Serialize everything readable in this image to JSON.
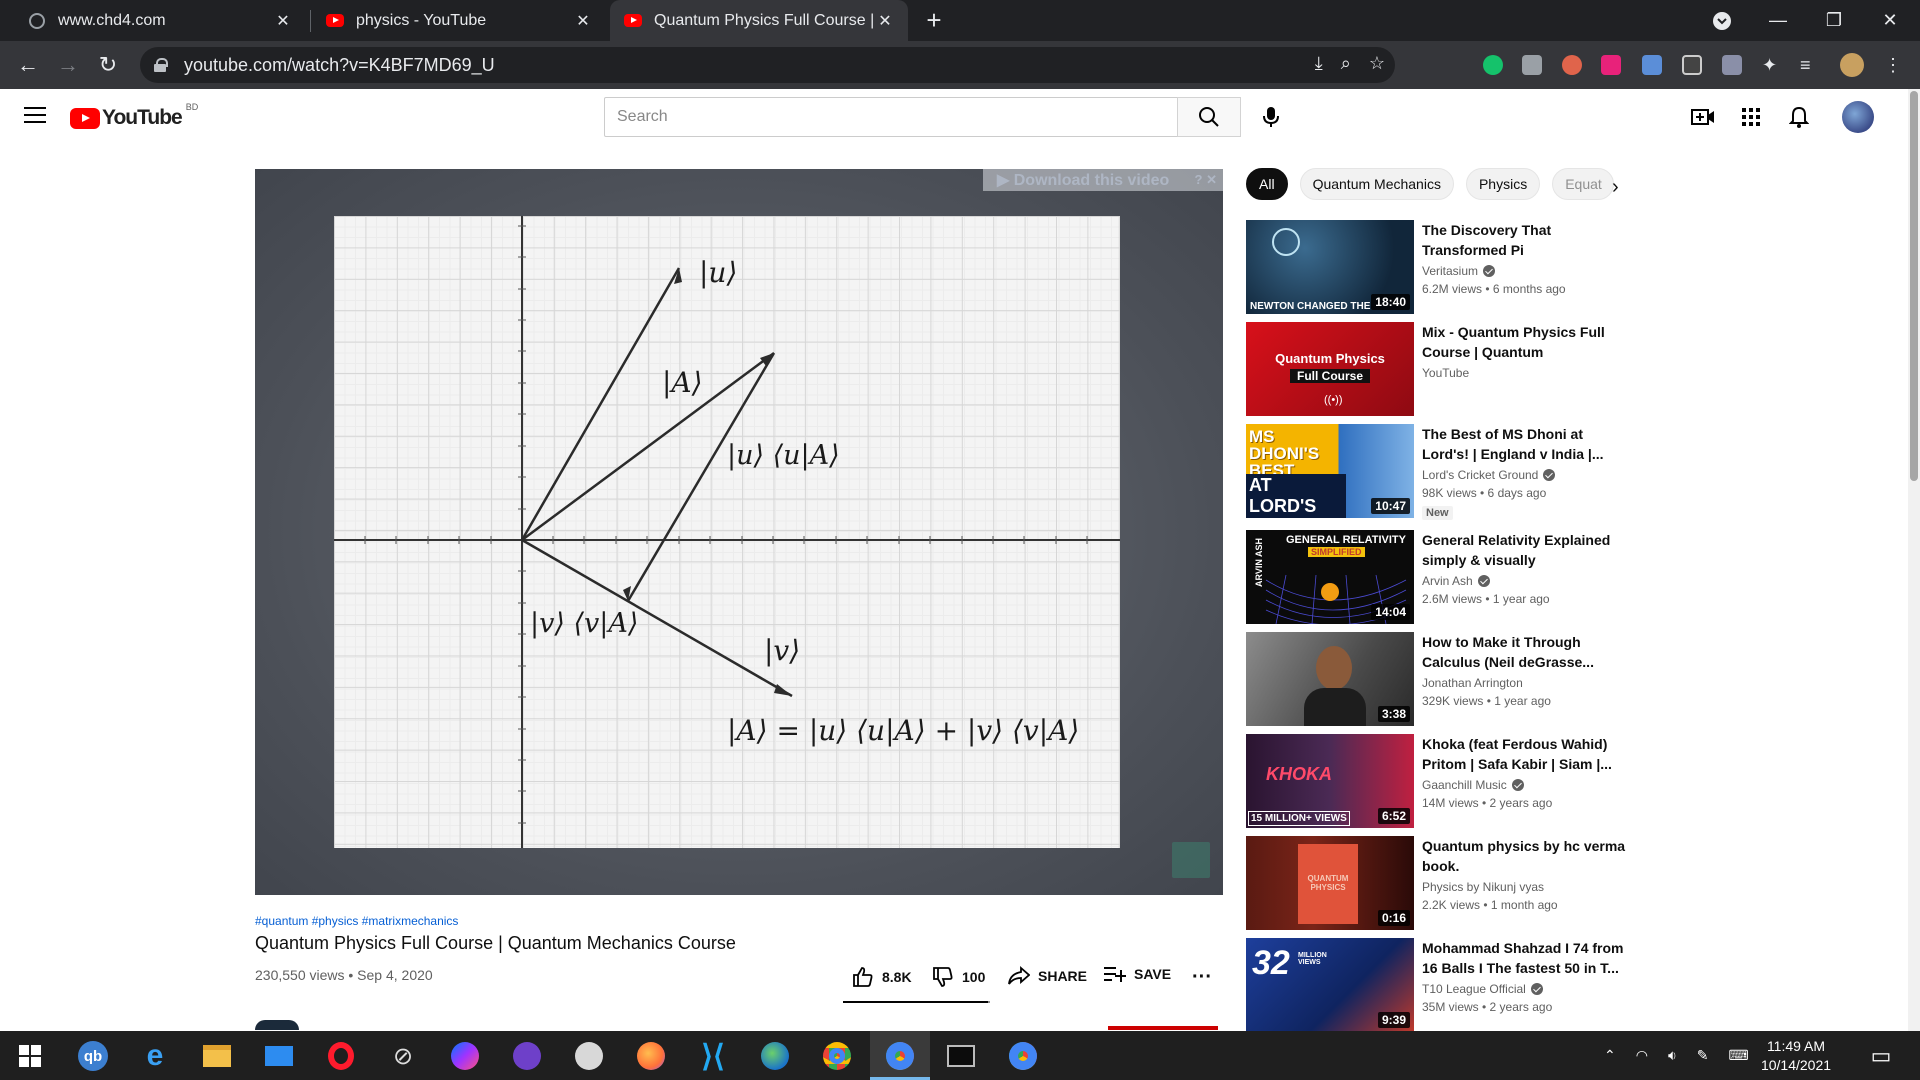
{
  "browser": {
    "tabs": [
      {
        "title": "www.chd4.com",
        "icon": "globe-icon"
      },
      {
        "title": "physics - YouTube",
        "icon": "youtube-icon"
      },
      {
        "title": "Quantum Physics Full Course | Qu",
        "icon": "youtube-icon",
        "active": true
      }
    ],
    "url": "youtube.com/watch?v=K4BF7MD69_U"
  },
  "youtube": {
    "logo_text": "YouTube",
    "country_code": "BD",
    "search_placeholder": "Search"
  },
  "player": {
    "download_banner": "▶ Download this video",
    "overlay": {
      "u_ket": "|u⟩",
      "A_ket": "|A⟩",
      "u_proj": "|u⟩ ⟨u|A⟩",
      "v_proj": "|v⟩ ⟨v|A⟩",
      "v_ket": "|v⟩",
      "equation": "|A⟩ = |u⟩ ⟨u|A⟩ + |v⟩ ⟨v|A⟩"
    }
  },
  "video": {
    "hashtags": "#quantum #physics #matrixmechanics",
    "title": "Quantum Physics Full Course | Quantum Mechanics Course",
    "meta": "230,550 views • Sep 4, 2020",
    "likes": "8.8K",
    "dislikes": "100",
    "like_ratio": 0.989,
    "share_label": "SHARE",
    "save_label": "SAVE"
  },
  "chips": [
    "All",
    "Quantum Mechanics",
    "Physics",
    "Equat"
  ],
  "recommendations": [
    {
      "title": "The Discovery That Transformed Pi",
      "channel": "Veritasium",
      "verified": true,
      "views": "6.2M views • 6 months ago",
      "duration": "18:40",
      "thumb_text": "NEWTON CHANGED THE",
      "thumb_color": "#1d3b5c"
    },
    {
      "title": "Mix - Quantum Physics Full Course | Quantum Mechanics...",
      "channel": "YouTube",
      "verified": false,
      "views": "",
      "duration": "",
      "thumb_text": "Quantum Physics",
      "thumb_text2": "Full Course",
      "thumb_color": "#c4101c"
    },
    {
      "title": "The Best of MS Dhoni at Lord's! | England v India |...",
      "channel": "Lord's Cricket Ground",
      "verified": true,
      "views": "98K views • 6 days ago",
      "duration": "10:47",
      "badge": "New",
      "thumb_text": "MS DHONI'S BEST MOMENTS",
      "thumb_text2": "AT LORD'S",
      "thumb_color": "#f2b705"
    },
    {
      "title": "General Relativity Explained simply & visually",
      "channel": "Arvin Ash",
      "verified": true,
      "views": "2.6M views • 1 year ago",
      "duration": "14:04",
      "thumb_text": "GENERAL RELATIVITY",
      "thumb_text2": "SIMPLIFIED",
      "thumb_color": "#111111"
    },
    {
      "title": "How to Make it Through Calculus (Neil deGrasse...",
      "channel": "Jonathan Arrington",
      "verified": false,
      "views": "329K views • 1 year ago",
      "duration": "3:38",
      "thumb_text": "",
      "thumb_color": "#6e6e6e"
    },
    {
      "title": "Khoka (feat Ferdous Wahid) Pritom | Safa Kabir | Siam |...",
      "channel": "Gaanchill Music",
      "verified": true,
      "views": "14M views • 2 years ago",
      "duration": "6:52",
      "thumb_text": "KHOKA",
      "thumb_text2": "15 MILLION+ VIEWS",
      "thumb_color": "#2a1c2e"
    },
    {
      "title": "Quantum physics by hc verma book.",
      "channel": "Physics by Nikunj vyas",
      "verified": false,
      "views": "2.2K views • 1 month ago",
      "duration": "0:16",
      "thumb_text": "QUANTUM PHYSICS",
      "thumb_color": "#5a1a12"
    },
    {
      "title": "Mohammad Shahzad I 74 from 16 Balls I The fastest 50 in T...",
      "channel": "T10 League Official",
      "verified": true,
      "views": "35M views • 2 years ago",
      "duration": "9:39",
      "thumb_text": "32",
      "thumb_text2": "MILLION VIEWS",
      "thumb_color": "#1b3a8a"
    }
  ],
  "taskbar": {
    "apps": [
      "windows-start-icon",
      "qbittorrent-icon",
      "edge-icon",
      "file-explorer-icon",
      "mail-icon",
      "opera-icon",
      "satellite-icon",
      "messenger-icon",
      "github-icon",
      "app-icon",
      "firefox-icon",
      "vscode-icon",
      "earth-icon",
      "chrome-icon",
      "chrome-icon",
      "terminal-icon",
      "chrome-icon"
    ],
    "time": "11:49 AM",
    "date": "10/14/2021"
  }
}
